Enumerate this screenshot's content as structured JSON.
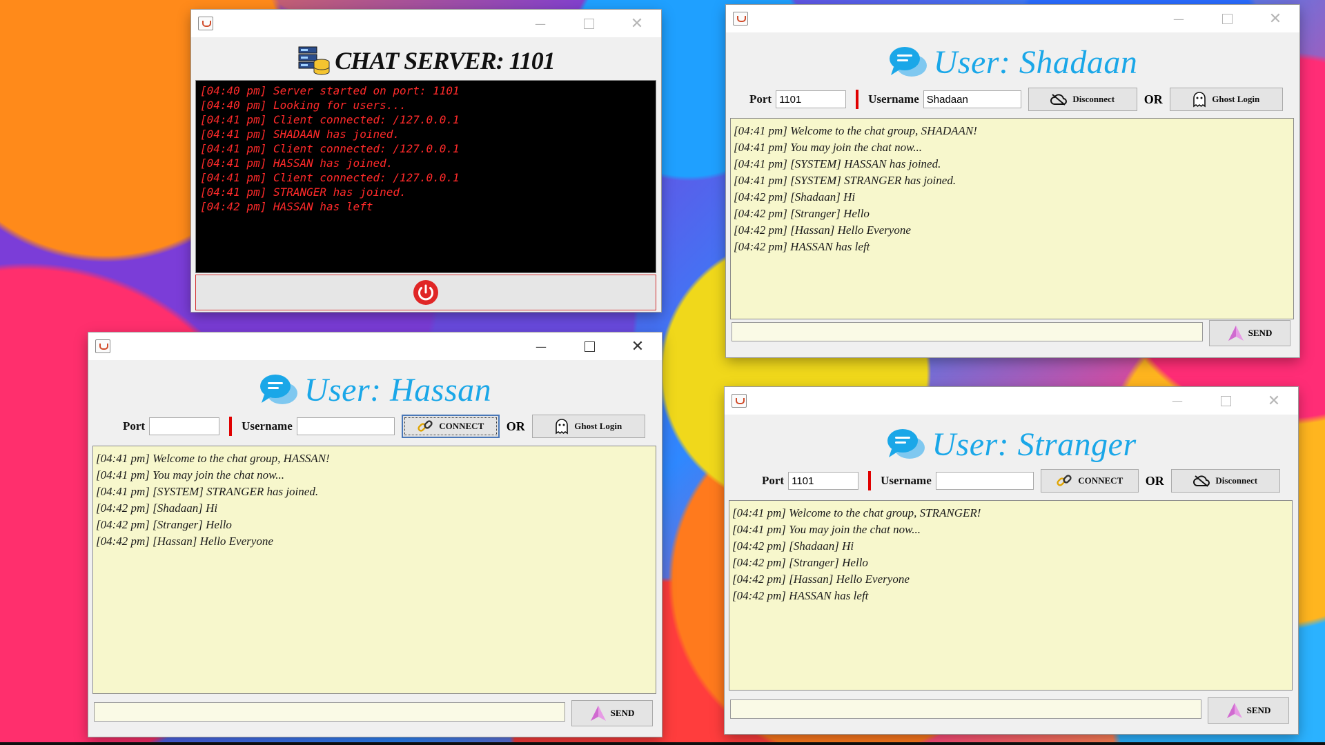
{
  "server": {
    "title": "CHAT SERVER: 1101",
    "log": [
      "[04:40 pm] Server started on port: 1101",
      "[04:40 pm] Looking for users...",
      "[04:41 pm] Client connected: /127.0.0.1",
      "[04:41 pm] SHADAAN has joined.",
      "[04:41 pm] Client connected: /127.0.0.1",
      "[04:41 pm] HASSAN has joined.",
      "[04:41 pm] Client connected: /127.0.0.1",
      "[04:41 pm] STRANGER has joined.",
      "[04:42 pm] HASSAN has left"
    ],
    "log_color": "#ff2a2a",
    "power_icon": "power-icon"
  },
  "labels": {
    "port": "Port",
    "username": "Username",
    "or": "OR",
    "send": "SEND",
    "connect": "CONNECT",
    "disconnect": "Disconnect",
    "ghost_login": "Ghost Login"
  },
  "shadaan": {
    "title": "User: Shadaan",
    "port_value": "1101",
    "username_value": "Shadaan",
    "log": [
      "[04:41 pm] Welcome to the chat group, SHADAAN!",
      "[04:41 pm] You may join the chat now...",
      "[04:41 pm] [SYSTEM] HASSAN has joined.",
      "[04:41 pm] [SYSTEM] STRANGER has joined.",
      "[04:42 pm] [Shadaan] Hi",
      "[04:42 pm] [Stranger] Hello",
      "[04:42 pm] [Hassan] Hello Everyone",
      "[04:42 pm] HASSAN has left"
    ]
  },
  "hassan": {
    "title": "User: Hassan",
    "port_value": "",
    "username_value": "",
    "log": [
      "[04:41 pm] Welcome to the chat group, HASSAN!",
      "[04:41 pm] You may join the chat now...",
      "[04:41 pm] [SYSTEM] STRANGER has joined.",
      "[04:42 pm] [Shadaan] Hi",
      "[04:42 pm] [Stranger] Hello",
      "[04:42 pm] [Hassan] Hello Everyone"
    ]
  },
  "stranger": {
    "title": "User: Stranger",
    "port_value": "1101",
    "username_value": "",
    "log": [
      "[04:41 pm] Welcome to the chat group, STRANGER!",
      "[04:41 pm] You may join the chat now...",
      "[04:42 pm] [Shadaan] Hi",
      "[04:42 pm] [Stranger] Hello",
      "[04:42 pm] [Hassan] Hello Everyone",
      "[04:42 pm] HASSAN has left"
    ]
  },
  "colors": {
    "accent_title": "#1aa7e8",
    "log_background": "#f7f7cc",
    "separator": "#e00000"
  }
}
